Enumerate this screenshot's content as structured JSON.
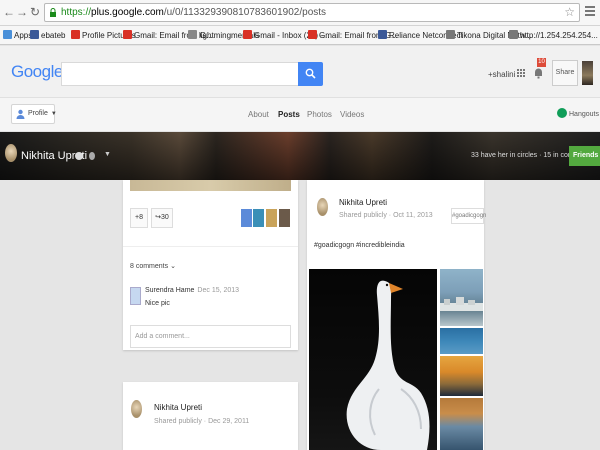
{
  "browser": {
    "url_scheme": "https://",
    "url_host": "plus.google.com",
    "url_path": "/u/0/113329390810783601902/posts",
    "bookmarks": [
      {
        "label": "Apps",
        "color": "#4a90d9"
      },
      {
        "label": "ebateb",
        "color": "#3b5998"
      },
      {
        "label": "Profile Pictures",
        "color": "#d93025"
      },
      {
        "label": "Gmail: Email from G...",
        "color": "#d93025"
      },
      {
        "label": "lightmingmentals",
        "color": "#888888"
      },
      {
        "label": "Gmail - Inbox (23) -...",
        "color": "#d93025"
      },
      {
        "label": "Gmail: Email from G...",
        "color": "#d93025"
      },
      {
        "label": "Reliance Netconnect",
        "color": "#3b5998"
      },
      {
        "label": "Tikona Digital Netw...",
        "color": "#777777"
      },
      {
        "label": "http://1.254.254.254...",
        "color": "#777777"
      }
    ]
  },
  "gbar": {
    "logo": "Google",
    "logo_plus": "+",
    "user": "+shalini",
    "notifications": "10",
    "share": "Share"
  },
  "pnav": {
    "profile": "Profile",
    "tabs": [
      "About",
      "Posts",
      "Photos",
      "Videos"
    ],
    "hangouts": "Hangouts"
  },
  "cover": {
    "name": "Nikhita Upreti",
    "circles": "33 have her in circles · 15 in common",
    "friends": "Friends"
  },
  "card1": {
    "plus_label": "+8",
    "share_count": "30",
    "comments_header": "8 comments",
    "comment_author": "Surendra Hame",
    "comment_date": "Dec 15, 2013",
    "comment_text": "Nice pic",
    "add_comment_placeholder": "Add a comment..."
  },
  "card2": {
    "author": "Nikhita Upreti",
    "meta": "Shared publicly · Dec 29, 2011"
  },
  "card3": {
    "author": "Nikhita Upreti",
    "meta": "Shared publicly · Oct 11, 2013",
    "tag": "#goadicgogn",
    "text": "#goadicgogn #incredibleindia"
  }
}
